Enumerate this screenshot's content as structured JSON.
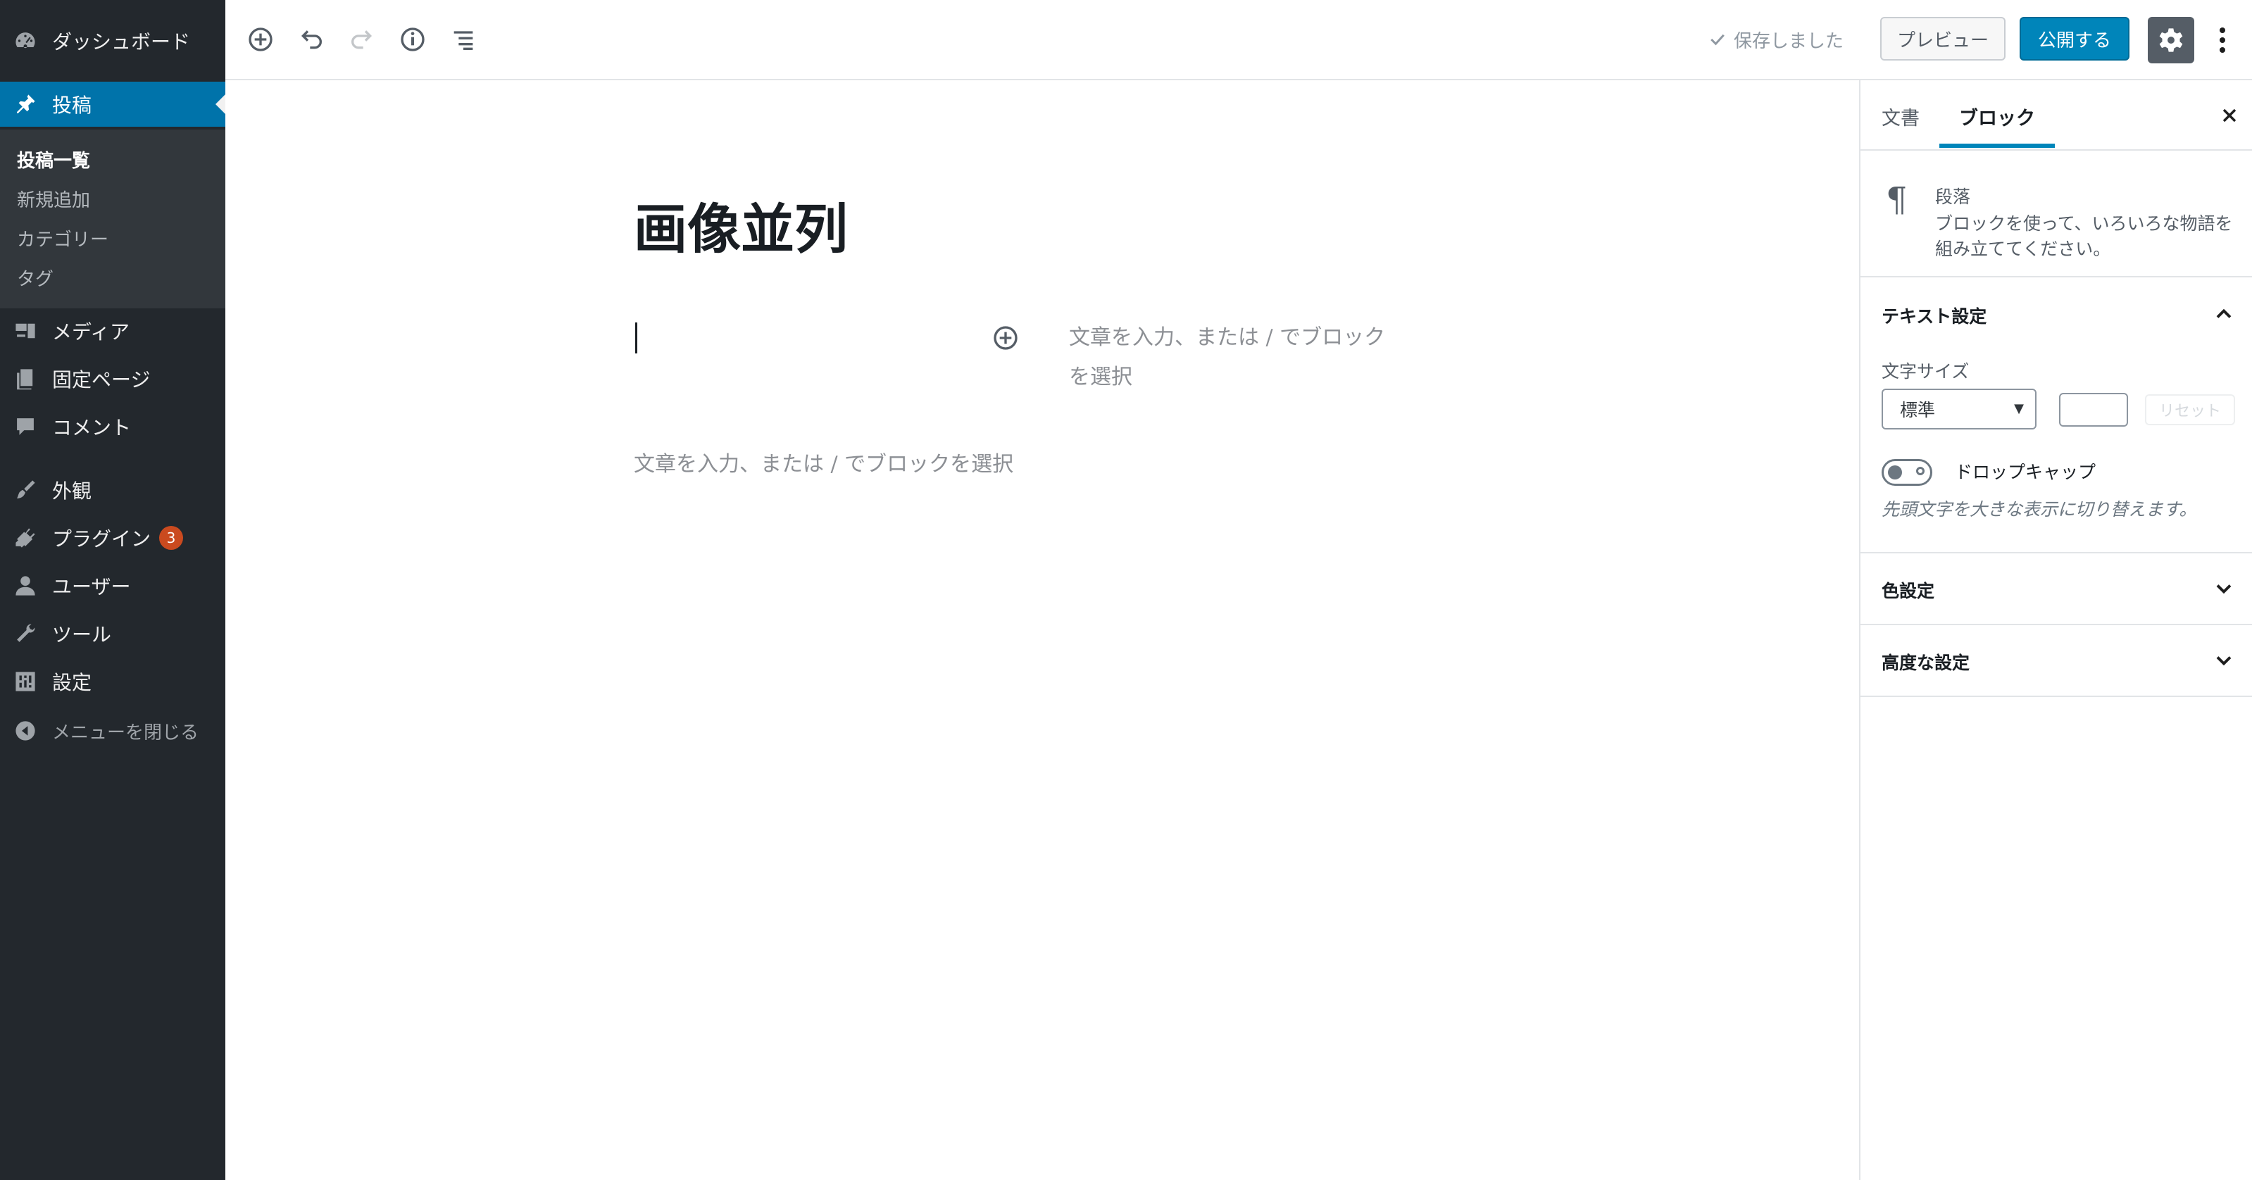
{
  "sidebar": {
    "items": [
      {
        "label": "ダッシュボード",
        "icon": "dashboard-icon"
      },
      {
        "label": "投稿",
        "icon": "pin-icon",
        "active": true
      },
      {
        "label": "メディア",
        "icon": "media-icon"
      },
      {
        "label": "固定ページ",
        "icon": "pages-icon"
      },
      {
        "label": "コメント",
        "icon": "comment-icon"
      },
      {
        "label": "外観",
        "icon": "appearance-icon"
      },
      {
        "label": "プラグイン",
        "icon": "plugin-icon",
        "badge": "3"
      },
      {
        "label": "ユーザー",
        "icon": "user-icon"
      },
      {
        "label": "ツール",
        "icon": "tools-icon"
      },
      {
        "label": "設定",
        "icon": "settings-icon"
      }
    ],
    "submenu": [
      "投稿一覧",
      "新規追加",
      "カテゴリー",
      "タグ"
    ],
    "collapse_label": "メニューを閉じる"
  },
  "toolbar": {
    "saved_label": "保存しました",
    "preview_label": "プレビュー",
    "publish_label": "公開する",
    "accent": "#0085ba"
  },
  "editor": {
    "title": "画像並列",
    "placeholder_1": "文章を入力、または / でブロックを選択",
    "placeholder_2": "文章を入力、または / でブロックを選択"
  },
  "panel": {
    "tabs": [
      "文書",
      "ブロック"
    ],
    "active_tab": "ブロック",
    "block_name": "段落",
    "block_description": "ブロックを使って、いろいろな物語を組み立ててください。",
    "text_settings_title": "テキスト設定",
    "font_size_label": "文字サイズ",
    "font_size_value": "標準",
    "reset_label": "リセット",
    "dropcap_label": "ドロップキャップ",
    "dropcap_help": "先頭文字を大きな表示に切り替えます。",
    "color_settings_title": "色設定",
    "advanced_title": "高度な設定"
  }
}
